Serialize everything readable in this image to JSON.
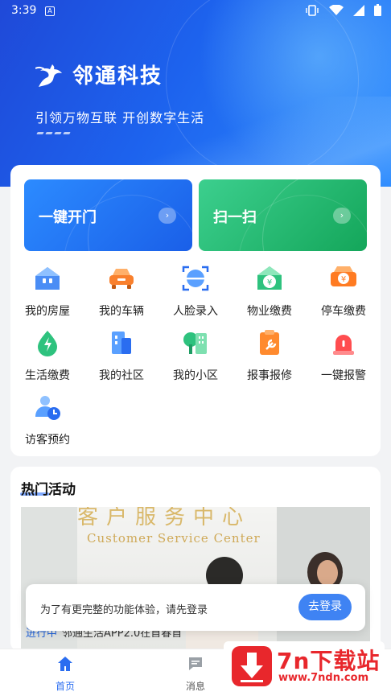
{
  "status_bar": {
    "time": "3:39",
    "notif_letter": "A"
  },
  "brand": {
    "name": "邻通科技",
    "slogan": "引领万物互联 开创数字生活"
  },
  "quick_actions": [
    {
      "label": "一键开门",
      "arrow": "›"
    },
    {
      "label": "扫一扫",
      "arrow": "›"
    }
  ],
  "services": [
    {
      "label": "我的房屋",
      "icon": "house-icon"
    },
    {
      "label": "我的车辆",
      "icon": "car-icon"
    },
    {
      "label": "人脸录入",
      "icon": "face-scan-icon"
    },
    {
      "label": "物业缴费",
      "icon": "property-fee-icon"
    },
    {
      "label": "停车缴费",
      "icon": "parking-fee-icon"
    },
    {
      "label": "生活缴费",
      "icon": "utility-fee-icon"
    },
    {
      "label": "我的社区",
      "icon": "community-icon"
    },
    {
      "label": "我的小区",
      "icon": "estate-icon"
    },
    {
      "label": "报事报修",
      "icon": "repair-icon"
    },
    {
      "label": "一键报警",
      "icon": "alarm-icon"
    },
    {
      "label": "访客预约",
      "icon": "visitor-icon"
    }
  ],
  "hot": {
    "title": "热门活动",
    "banner_sign_cn": "客户服务中心",
    "banner_sign_en": "Customer Service Center",
    "peek_status": "进行中",
    "peek_title": "邻通生活APP2.0在首春首"
  },
  "login_prompt": {
    "message": "为了有更完整的功能体验，请先登录",
    "button": "去登录"
  },
  "tabs": [
    {
      "label": "首页",
      "icon": "home-icon",
      "active": true
    },
    {
      "label": "消息",
      "icon": "message-icon",
      "active": false
    }
  ],
  "watermark": {
    "text": "7n下载站",
    "url": "www.7ndn.com"
  },
  "colors": {
    "primary": "#2a6df0",
    "green": "#14a65a",
    "red": "#e8272c"
  }
}
